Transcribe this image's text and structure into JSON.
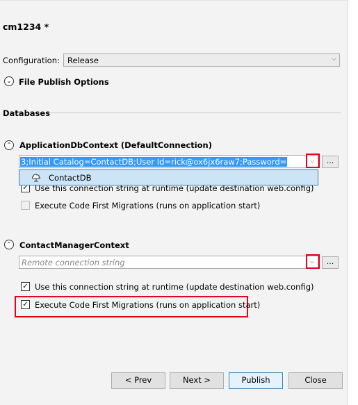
{
  "title": "cm1234 *",
  "configuration": {
    "label": "Configuration:",
    "value": "Release"
  },
  "file_publish_options": {
    "label": "File Publish Options"
  },
  "databases": {
    "label": "Databases"
  },
  "app_db": {
    "header": "ApplicationDbContext (DefaultConnection)",
    "connection_string": "3;Initial Catalog=ContactDB;User Id=rick@ox6jx6raw7;Password=",
    "browse_label": "...",
    "dropdown_item": "ContactDB",
    "use_at_runtime": {
      "label": "Use this connection string at runtime (update destination web.config)",
      "checked": true
    },
    "code_first": {
      "label": "Execute Code First Migrations (runs on application start)",
      "checked": false,
      "disabled": true
    }
  },
  "contact_mgr": {
    "header": "ContactManagerContext",
    "placeholder": "Remote connection string",
    "browse_label": "...",
    "use_at_runtime": {
      "label": "Use this connection string at runtime (update destination web.config)",
      "checked": true
    },
    "code_first": {
      "label": "Execute Code First Migrations (runs on application start)",
      "checked": true
    }
  },
  "buttons": {
    "prev": "< Prev",
    "next": "Next >",
    "publish": "Publish",
    "close": "Close"
  },
  "colors": {
    "highlight_red": "#e8001c",
    "selection_blue": "#3399ff",
    "dropdown_bg": "#cde4f7"
  }
}
